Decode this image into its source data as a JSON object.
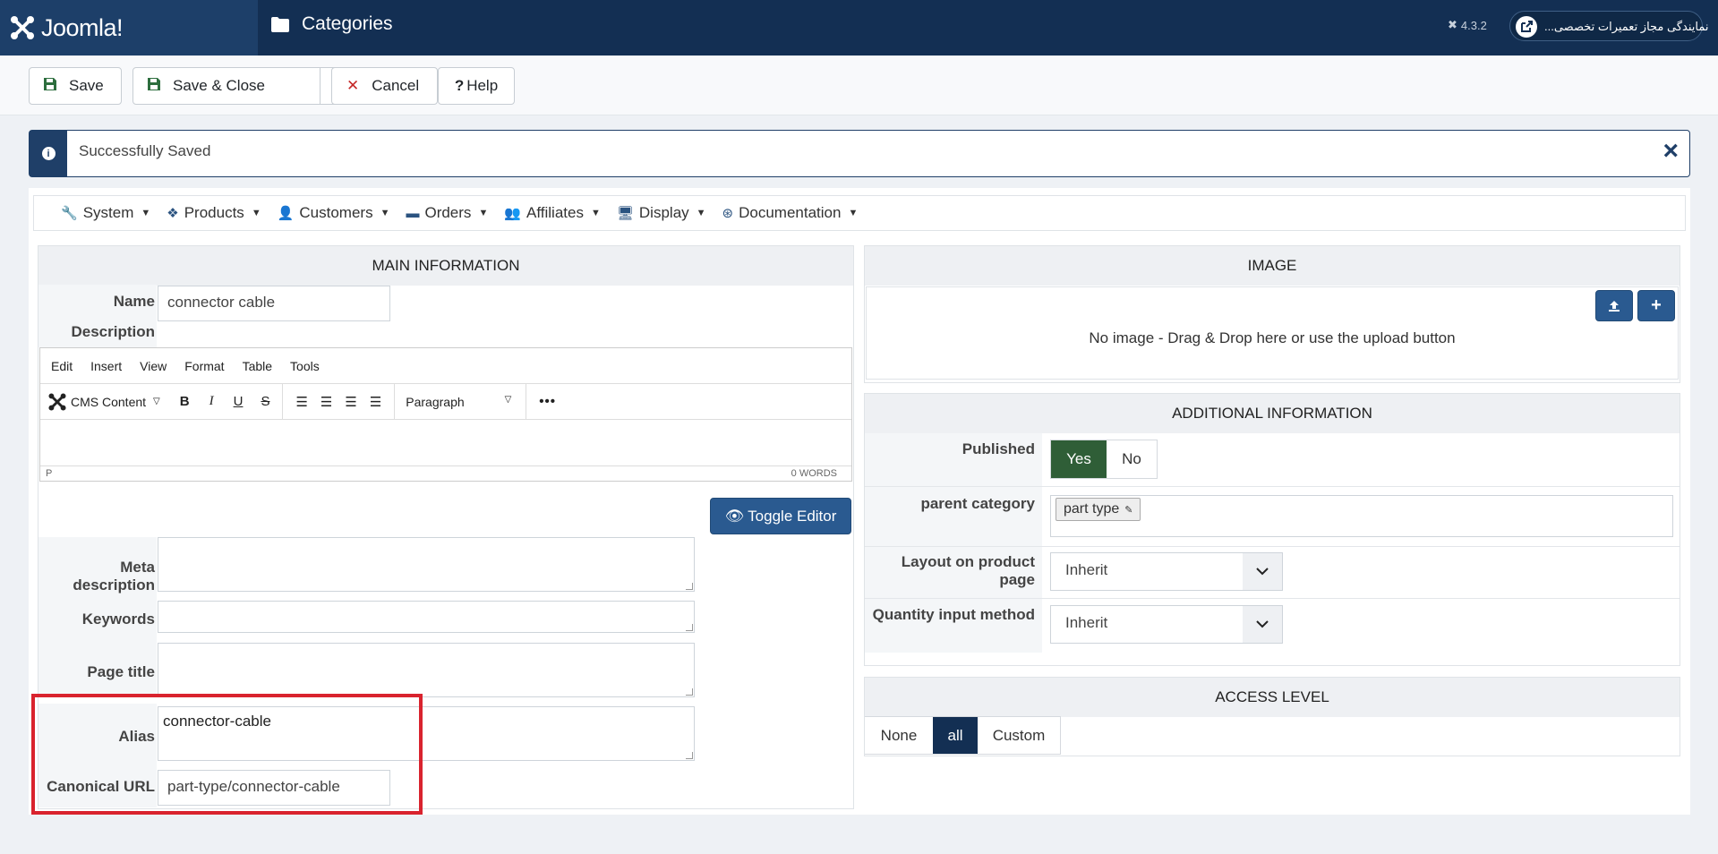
{
  "header": {
    "brand": "Joomla!",
    "page_title": "Categories",
    "version": "4.3.2",
    "site_label": "نمایندگی مجاز تعمیرات تخصصی..."
  },
  "toolbar": {
    "save": "Save",
    "save_close": "Save & Close",
    "cancel": "Cancel",
    "help": "Help"
  },
  "alert": {
    "message": "Successfully Saved",
    "close": "×"
  },
  "nav": {
    "items": [
      "System",
      "Products",
      "Customers",
      "Orders",
      "Affiliates",
      "Display",
      "Documentation"
    ]
  },
  "main_info": {
    "title": "MAIN INFORMATION",
    "name_label": "Name",
    "name_value": "connector cable",
    "description_label": "Description",
    "editor": {
      "menu": [
        "Edit",
        "Insert",
        "View",
        "Format",
        "Table",
        "Tools"
      ],
      "cms_content": "CMS Content",
      "block_format": "Paragraph",
      "status_path": "P",
      "word_count": "0 WORDS"
    },
    "toggle_editor": "Toggle Editor",
    "meta_description_label": "Meta description",
    "keywords_label": "Keywords",
    "page_title_label": "Page title",
    "alias_label": "Alias",
    "alias_value": "connector-cable",
    "canonical_label": "Canonical URL",
    "canonical_value": "part-type/connector-cable"
  },
  "image": {
    "title": "IMAGE",
    "empty_text": "No image - Drag & Drop here or use the upload button"
  },
  "additional": {
    "title": "ADDITIONAL INFORMATION",
    "published_label": "Published",
    "yes": "Yes",
    "no": "No",
    "parent_label": "parent category",
    "parent_tag": "part type",
    "layout_label": "Layout on product page",
    "layout_value": "Inherit",
    "qty_label": "Quantity input method",
    "qty_value": "Inherit"
  },
  "access": {
    "title": "ACCESS LEVEL",
    "options": [
      "None",
      "all",
      "Custom"
    ]
  }
}
